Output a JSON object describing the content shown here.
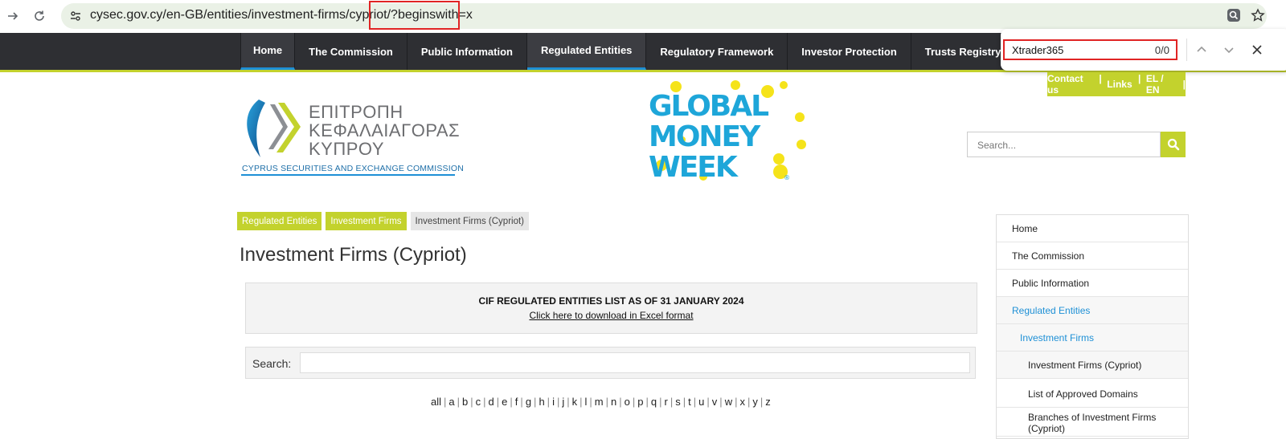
{
  "browser": {
    "url_host": "cysec.gov.cy/en-GB/entities/investment-firms/cypriot",
    "url_query": "/?beginswith=x",
    "find": {
      "query": "Xtrader365",
      "count": "0/0"
    }
  },
  "nav": {
    "items": [
      "Home",
      "The Commission",
      "Public Information",
      "Regulated Entities",
      "Regulatory Framework",
      "Investor Protection",
      "Trusts Registry"
    ]
  },
  "contact": {
    "contact_label": "Contact us",
    "links_label": "Links",
    "lang_label": "EL / EN"
  },
  "logo": {
    "line1": "ΕΠΙΤΡΟΠΗ",
    "line2": "ΚΕΦΑΛΑΙΑΓΟΡΑΣ",
    "line3": "ΚΥΠΡΟΥ",
    "sub": "CYPRUS SECURITIES AND EXCHANGE COMMISSION"
  },
  "banner": {
    "line1": "GLOBAL",
    "line2": "MONEY",
    "line3": "WEEK"
  },
  "site_search": {
    "placeholder": "Search..."
  },
  "breadcrumb": [
    "Regulated Entities",
    "Investment Firms",
    "Investment Firms (Cypriot)"
  ],
  "page": {
    "title": "Investment Firms (Cypriot)",
    "list_title": "CIF REGULATED ENTITIES LIST AS OF 31 JANUARY 2024",
    "download_link": "Click here to download in Excel format",
    "search_label": "Search:"
  },
  "alphabet": [
    "all",
    "a",
    "b",
    "c",
    "d",
    "e",
    "f",
    "g",
    "h",
    "i",
    "j",
    "k",
    "l",
    "m",
    "n",
    "o",
    "p",
    "q",
    "r",
    "s",
    "t",
    "u",
    "v",
    "w",
    "x",
    "y",
    "z"
  ],
  "side_menu": [
    "Home",
    "The Commission",
    "Public Information",
    "Regulated Entities",
    "Investment Firms",
    "Investment Firms (Cypriot)",
    "List of Approved Domains",
    "Branches of Investment Firms (Cypriot)"
  ],
  "colors": {
    "accent_green": "#c3d22d",
    "nav_dark": "#2e2f33",
    "link_blue": "#1e90d6",
    "highlight_red": "#e02424"
  }
}
